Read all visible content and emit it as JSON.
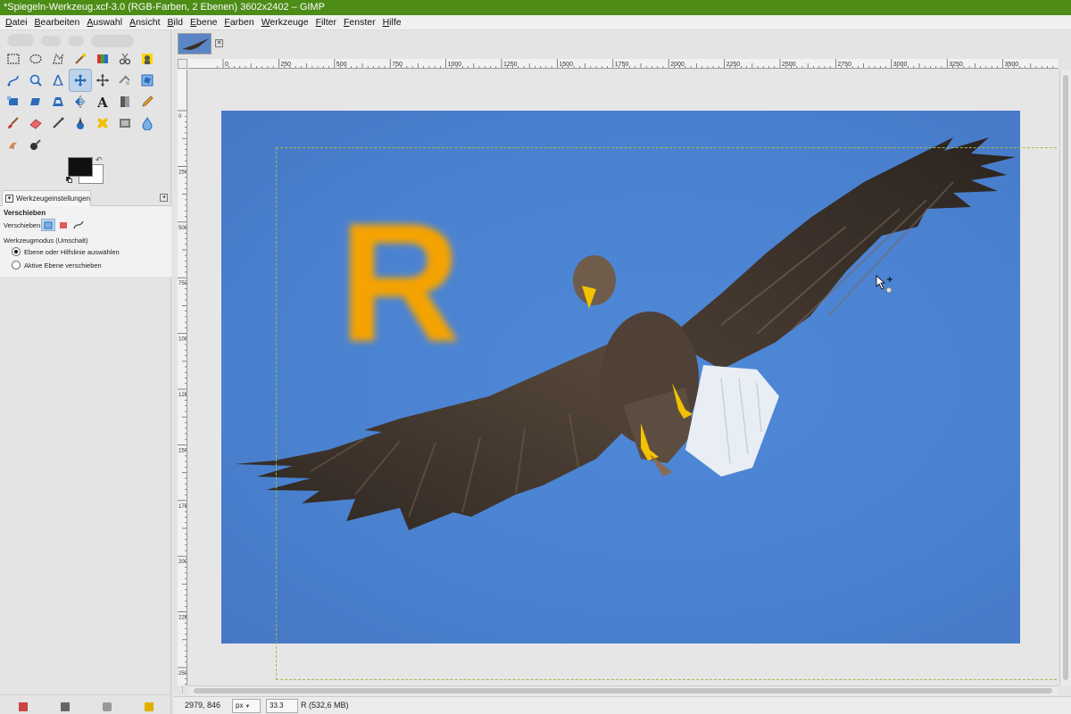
{
  "window": {
    "title": "*Spiegeln-Werkzeug.xcf-3.0 (RGB-Farben, 2 Ebenen) 3602x2402 – GIMP"
  },
  "menu": [
    "Datei",
    "Bearbeiten",
    "Auswahl",
    "Ansicht",
    "Bild",
    "Ebene",
    "Farben",
    "Werkzeuge",
    "Filter",
    "Fenster",
    "Hilfe"
  ],
  "toolbox": {
    "rows": [
      [
        "rect-select-icon",
        "ellipse-select-icon",
        "free-select-icon",
        "fuzzy-select-icon",
        "color-select-icon",
        "scissors-select-icon",
        "foreground-select-icon"
      ],
      [
        "paths-icon",
        "zoom-icon",
        "measure-icon",
        "move-icon",
        "alignment-icon",
        "crop-icon",
        "rotate-icon"
      ],
      [
        "scale-icon",
        "shear-icon",
        "perspective-icon",
        "flip-icon",
        "text-icon",
        "bucket-fill-icon",
        "pencil-icon"
      ],
      [
        "paintbrush-icon",
        "eraser-icon",
        "airbrush-icon",
        "ink-icon",
        "heal-icon",
        "clone-icon",
        "blur-icon"
      ],
      [
        "smudge-icon",
        "dodge-burn-icon"
      ]
    ],
    "active_tool": "move-icon"
  },
  "colors": {
    "foreground": "#111111",
    "background": "#ffffff"
  },
  "tool_options": {
    "tab_label": "Werkzeugeinstellungen",
    "tool_name": "Verschieben",
    "move_label": "Verschieben:",
    "mode_label": "Werkzeugmodus (Umschalt)",
    "radio_1": "Ebene oder Hilfslinie auswählen",
    "radio_2": "Aktive Ebene verschieben",
    "selected_radio": 1
  },
  "rulers": {
    "h_labels": [
      "0",
      "250",
      "500",
      "750",
      "1000",
      "1250",
      "1500",
      "1750",
      "2000",
      "2250",
      "2500",
      "2750",
      "3000",
      "3250",
      "3500"
    ],
    "v_labels": [
      "0",
      "250",
      "500",
      "750",
      "1000",
      "1250",
      "1500",
      "1750",
      "2000",
      "2250",
      "2500"
    ]
  },
  "canvas": {
    "overlay_letter": "R",
    "overlay_color": "#f5a300",
    "sky_color": "#4a82d0"
  },
  "status": {
    "coords": "2979, 846",
    "unit": "px",
    "zoom": "33.3 %",
    "message": "R (532,6 MB)"
  }
}
